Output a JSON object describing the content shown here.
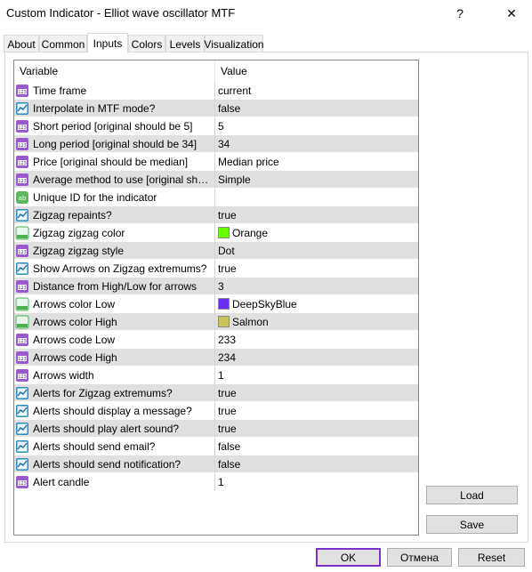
{
  "window": {
    "title": "Custom Indicator - Elliot wave oscillator MTF",
    "help_label": "?",
    "close_label": "✕"
  },
  "tabs": [
    {
      "label": "About"
    },
    {
      "label": "Common"
    },
    {
      "label": "Inputs"
    },
    {
      "label": "Colors"
    },
    {
      "label": "Levels"
    },
    {
      "label": "Visualization"
    }
  ],
  "active_tab": "Inputs",
  "grid": {
    "header_variable": "Variable",
    "header_value": "Value",
    "rows": [
      {
        "icon": "int-icon",
        "variable": "Time frame",
        "value": "current"
      },
      {
        "icon": "bool-icon",
        "variable": "Interpolate in MTF mode?",
        "value": "false"
      },
      {
        "icon": "int-icon",
        "variable": "Short period [original should be 5]",
        "value": "5"
      },
      {
        "icon": "int-icon",
        "variable": "Long period [original should be 34]",
        "value": "34"
      },
      {
        "icon": "int-icon",
        "variable": "Price [original should be median]",
        "value": "Median price"
      },
      {
        "icon": "int-icon",
        "variable": "Average method to use [original should be simple]",
        "value": "Simple"
      },
      {
        "icon": "string-icon",
        "variable": "Unique ID for the indicator",
        "value": ""
      },
      {
        "icon": "bool-icon",
        "variable": "Zigzag repaints?",
        "value": "true"
      },
      {
        "icon": "color-icon",
        "variable": "Zigzag zigzag color",
        "value": "Orange",
        "swatch": "#66ff00"
      },
      {
        "icon": "int-icon",
        "variable": "Zigzag zigzag style",
        "value": "Dot"
      },
      {
        "icon": "bool-icon",
        "variable": "Show Arrows on Zigzag extremums?",
        "value": "true"
      },
      {
        "icon": "int-icon",
        "variable": "Distance from High/Low for arrows",
        "value": "3"
      },
      {
        "icon": "color-icon",
        "variable": "Arrows color Low",
        "value": "DeepSkyBlue",
        "swatch": "#6a2ef0"
      },
      {
        "icon": "color-icon",
        "variable": "Arrows color High",
        "value": "Salmon",
        "swatch": "#c9c45a"
      },
      {
        "icon": "int-icon",
        "variable": "Arrows code Low",
        "value": "233"
      },
      {
        "icon": "int-icon",
        "variable": "Arrows code High",
        "value": "234"
      },
      {
        "icon": "int-icon",
        "variable": "Arrows width",
        "value": "1"
      },
      {
        "icon": "bool-icon",
        "variable": "Alerts for Zigzag extremums?",
        "value": "true"
      },
      {
        "icon": "bool-icon",
        "variable": "Alerts should display a message?",
        "value": "true"
      },
      {
        "icon": "bool-icon",
        "variable": "Alerts should play alert sound?",
        "value": "true"
      },
      {
        "icon": "bool-icon",
        "variable": "Alerts should send email?",
        "value": "false"
      },
      {
        "icon": "bool-icon",
        "variable": "Alerts should send notification?",
        "value": "false"
      },
      {
        "icon": "int-icon",
        "variable": "Alert candle",
        "value": "1"
      }
    ]
  },
  "buttons": {
    "load": "Load",
    "save": "Save",
    "ok": "OK",
    "cancel": "Отмена",
    "reset": "Reset"
  },
  "colors": {
    "ok_focus_border": "#7a31c9",
    "int_icon": "#9b59d0",
    "bool_icon": "#2a8fbf",
    "string_icon": "#5cb85c",
    "color_icon": "#4caf50"
  }
}
